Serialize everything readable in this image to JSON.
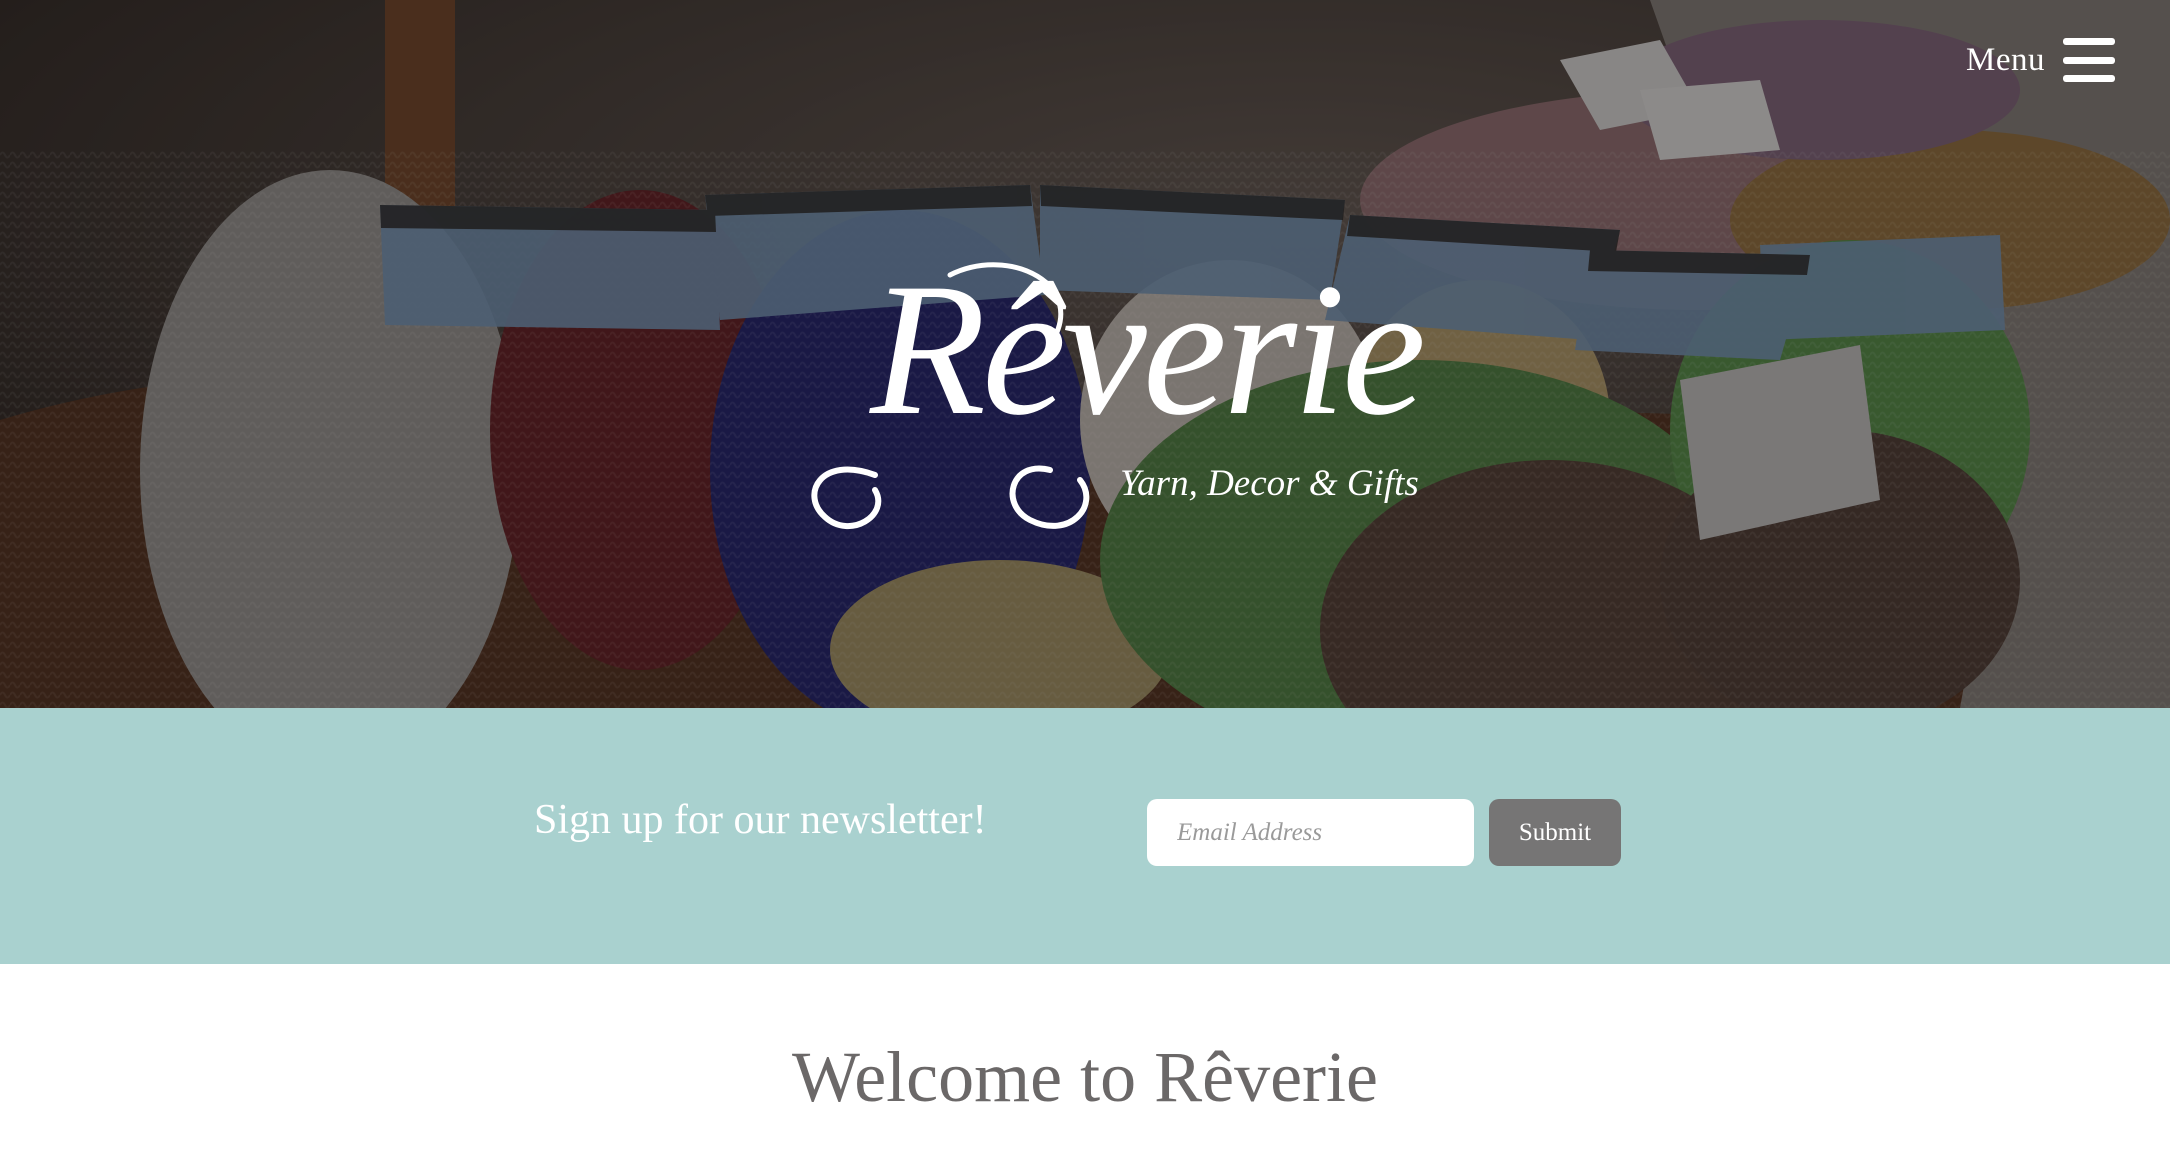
{
  "header": {
    "menu_label": "Menu"
  },
  "hero": {
    "logo_word": "Rêverie",
    "logo_tagline": "Yarn, Decor & Gifts"
  },
  "newsletter": {
    "heading": "Sign up for our newsletter!",
    "email_placeholder": "Email Address",
    "email_value": "",
    "submit_label": "Submit"
  },
  "welcome": {
    "title": "Welcome to Rêverie"
  },
  "icons": {
    "menu": "hamburger-menu-icon"
  },
  "colors": {
    "newsletter_bg": "#a9d1cf",
    "submit_bg": "#767575",
    "welcome_text": "#6b6868",
    "white": "#ffffff"
  }
}
